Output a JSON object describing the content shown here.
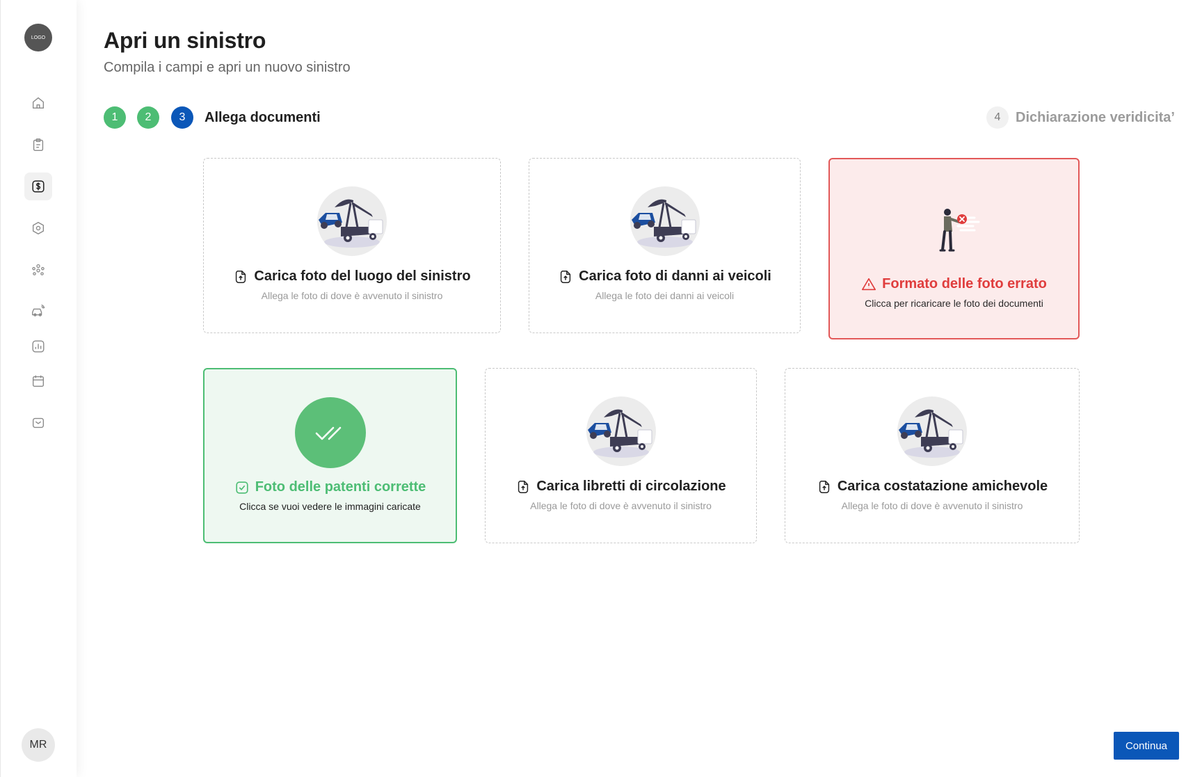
{
  "sidebar": {
    "logo": "LOGO",
    "items": [
      {
        "icon": "home-icon"
      },
      {
        "icon": "clipboard-icon"
      },
      {
        "icon": "dollar-icon",
        "active": true
      },
      {
        "icon": "hexagon-icon"
      },
      {
        "icon": "people-icon"
      },
      {
        "icon": "car-icon"
      },
      {
        "icon": "chart-icon"
      },
      {
        "icon": "calendar-icon"
      },
      {
        "icon": "inbox-icon"
      }
    ],
    "avatar": "MR"
  },
  "header": {
    "title": "Apri un sinistro",
    "subtitle": "Compila i campi e apri un nuovo sinistro"
  },
  "stepper": {
    "steps": [
      {
        "number": "1",
        "status": "done"
      },
      {
        "number": "2",
        "status": "done"
      },
      {
        "number": "3",
        "status": "current",
        "label": "Allega documenti"
      },
      {
        "number": "4",
        "status": "pending",
        "label": "Dichiarazione veridicita’"
      }
    ]
  },
  "cards": [
    {
      "state": "upload",
      "title": "Carica foto del luogo del sinistro",
      "subtitle": "Allega le foto di dove è avvenuto il sinistro"
    },
    {
      "state": "upload",
      "title": "Carica foto di danni ai veicoli",
      "subtitle": "Allega le foto dei danni ai veicoli"
    },
    {
      "state": "error",
      "title": "Formato delle foto errato",
      "subtitle": "Clicca per ricaricare le foto dei documenti"
    },
    {
      "state": "success",
      "title": "Foto delle patenti corrette",
      "subtitle": "Clicca se vuoi vedere le immagini caricate"
    },
    {
      "state": "upload",
      "title": "Carica libretti di circolazione",
      "subtitle": "Allega le foto di dove è avvenuto il sinistro"
    },
    {
      "state": "upload",
      "title": "Carica costatazione amichevole",
      "subtitle": "Allega le foto di dove è avvenuto il sinistro"
    }
  ],
  "actions": {
    "continue_label": "Continua"
  },
  "colors": {
    "primary": "#0b57b8",
    "success": "#4dbd74",
    "error": "#e03d3d",
    "error_bg": "#fcebeb",
    "success_bg": "#eef8f1"
  }
}
